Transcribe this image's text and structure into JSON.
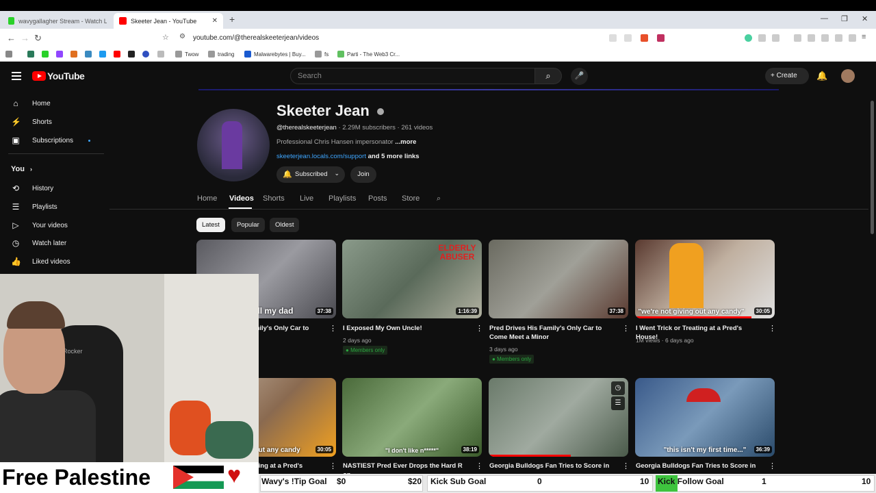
{
  "browser": {
    "tabs": [
      {
        "title": "wavygallagher Stream - Watch Live o...",
        "active": false
      },
      {
        "title": "Skeeter Jean - YouTube",
        "active": true
      }
    ],
    "url": "youtube.com/@therealskeeterjean/videos",
    "bookmarks": [
      "Twow",
      "trading",
      "Malwarebytes | Buy...",
      "fs",
      "Parti - The Web3 Cr..."
    ]
  },
  "youtube": {
    "logo_text": "YouTube",
    "search_placeholder": "Search",
    "create_label": "Create",
    "sidebar": {
      "items": [
        {
          "label": "Home",
          "icon": "home-icon"
        },
        {
          "label": "Shorts",
          "icon": "shorts-icon"
        },
        {
          "label": "Subscriptions",
          "icon": "subscriptions-icon"
        }
      ],
      "you_label": "You",
      "you_items": [
        {
          "label": "History",
          "icon": "history-icon"
        },
        {
          "label": "Playlists",
          "icon": "playlists-icon"
        },
        {
          "label": "Your videos",
          "icon": "your-videos-icon"
        },
        {
          "label": "Watch later",
          "icon": "watch-later-icon"
        },
        {
          "label": "Liked videos",
          "icon": "liked-icon"
        }
      ]
    },
    "channel": {
      "name": "Skeeter Jean",
      "handle": "@therealskeeterjean",
      "subscribers": "2.29M subscribers",
      "videos_count": "261 videos",
      "description": "Professional Chris Hansen impersonator",
      "more": "...more",
      "link": "skeeterjean.locals.com/support",
      "more_links": "and 5 more links",
      "subscribed_label": "Subscribed",
      "join_label": "Join"
    },
    "tabs": [
      "Home",
      "Videos",
      "Shorts",
      "Live",
      "Playlists",
      "Posts",
      "Store"
    ],
    "active_tab": "Videos",
    "chips": [
      "Latest",
      "Popular",
      "Oldest"
    ],
    "videos": [
      {
        "title": "Pred Drives His Family's Only Car to Meet a",
        "duration": "37:38",
        "caption": "I'll tell my dad",
        "meta": "",
        "members": false
      },
      {
        "title": "I Exposed My Own Uncle!",
        "duration": "1:16:39",
        "caption": "ELDERLY ABUSER",
        "meta": "2 days ago",
        "members": true
      },
      {
        "title": "Pred Drives His Family's Only Car to Come Meet a Minor",
        "duration": "37:38",
        "caption": "",
        "meta": "3 days ago",
        "members": true
      },
      {
        "title": "I Went Trick or Treating at a Pred's House!",
        "duration": "30:05",
        "caption": "\"we're not giving out any candy\"",
        "meta": "1M views · 6 days ago",
        "members": false
      },
      {
        "title": "I Went Trick or Treating at a Pred's House!",
        "duration": "30:05",
        "caption": "giving out any candy",
        "meta": "",
        "members": false
      },
      {
        "title": "NASTIEST Pred Ever Drops the Hard R on",
        "duration": "38:19",
        "caption": "\"I don't like n*****\"",
        "meta": "",
        "members": false
      },
      {
        "title": "Georgia Bulldogs Fan Tries to Score in",
        "duration": "",
        "caption": "",
        "meta": "",
        "members": false
      },
      {
        "title": "Georgia Bulldogs Fan Tries to Score in",
        "duration": "36:39",
        "caption": "\"this isn't my first time...\"",
        "meta": "",
        "members": false
      }
    ],
    "members_label": "Members only"
  },
  "overlay": {
    "banner": "Free Palestine",
    "chair_text": "Rocker",
    "goals": [
      {
        "label": "Wavy's !Tip Goal",
        "current": "$0",
        "target": "$20",
        "progress": 0
      },
      {
        "label": "Kick Sub Goal",
        "current": "0",
        "target": "10",
        "progress": 0
      },
      {
        "label": "Kick Follow Goal",
        "current": "1",
        "target": "10",
        "progress": 0.1
      }
    ]
  }
}
